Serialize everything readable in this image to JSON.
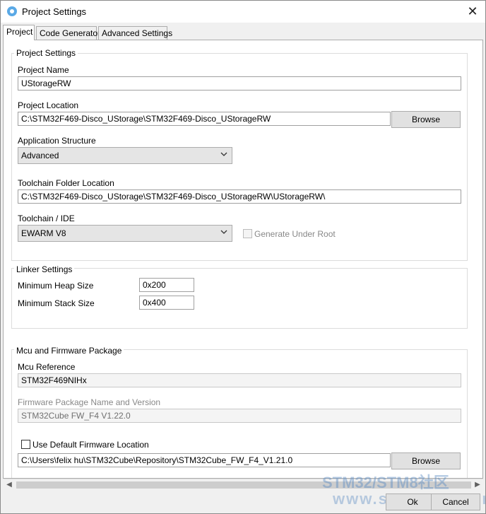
{
  "window": {
    "title": "Project Settings",
    "close_glyph": "✕"
  },
  "tabs": [
    "Project",
    "Code Generator",
    "Advanced Settings"
  ],
  "project_settings": {
    "group_title": "Project Settings",
    "project_name_label": "Project Name",
    "project_name_value": "UStorageRW",
    "project_location_label": "Project Location",
    "project_location_value": "C:\\STM32F469-Disco_UStorage\\STM32F469-Disco_UStorageRW",
    "browse_label": "Browse",
    "app_structure_label": "Application Structure",
    "app_structure_value": "Advanced",
    "toolchain_folder_label": "Toolchain Folder Location",
    "toolchain_folder_value": "C:\\STM32F469-Disco_UStorage\\STM32F469-Disco_UStorageRW\\UStorageRW\\",
    "toolchain_ide_label": "Toolchain / IDE",
    "toolchain_ide_value": "EWARM V8",
    "generate_under_root_label": "Generate Under Root"
  },
  "linker_settings": {
    "group_title": "Linker Settings",
    "heap_label": "Minimum Heap Size",
    "heap_value": "0x200",
    "stack_label": "Minimum Stack Size",
    "stack_value": "0x400"
  },
  "mcu_package": {
    "group_title": "Mcu and Firmware Package",
    "mcu_ref_label": "Mcu Reference",
    "mcu_ref_value": "STM32F469NIHx",
    "fw_name_label": "Firmware Package Name and Version",
    "fw_name_value": "STM32Cube FW_F4 V1.22.0",
    "use_default_label": "Use Default Firmware Location",
    "fw_location_value": "C:\\Users\\felix hu\\STM32Cube\\Repository\\STM32Cube_FW_F4_V1.21.0",
    "browse_label": "Browse"
  },
  "footer": {
    "ok_label": "Ok",
    "cancel_label": "Cancel"
  },
  "watermark": {
    "line1": "STM32/STM8社区",
    "line2": "www.stmcu.org.cn"
  },
  "icons": [
    "app-icon",
    "close-icon",
    "chevron-down-icon",
    "scroll-left-icon",
    "scroll-right-icon"
  ]
}
